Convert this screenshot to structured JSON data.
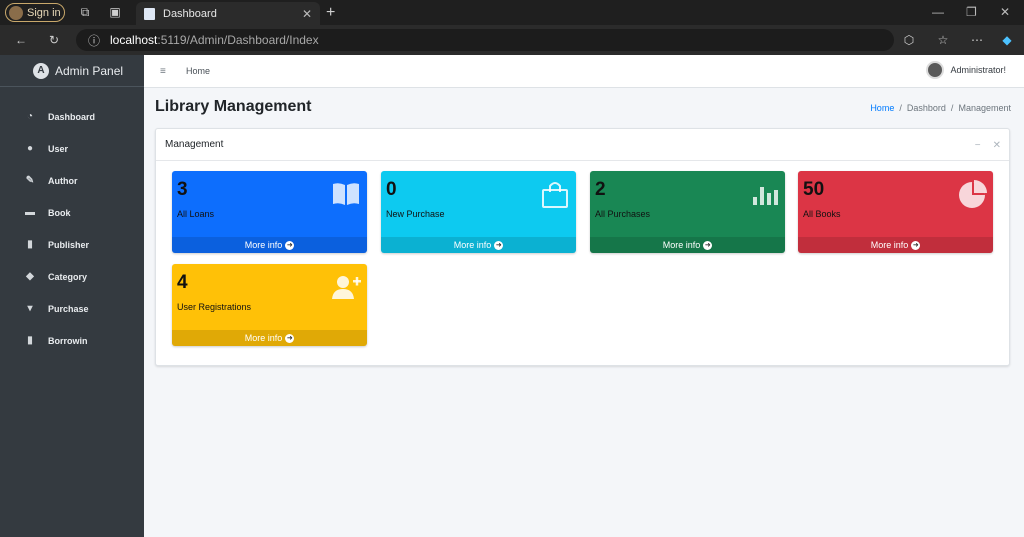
{
  "browser": {
    "signin_label": "Sign in",
    "tab_title": "Dashboard",
    "url_host": "localhost",
    "url_path": ":5119/Admin/Dashboard/Index"
  },
  "sidebar": {
    "brand": "Admin Panel",
    "items": [
      {
        "label": "Dashboard",
        "icon": "palette-icon"
      },
      {
        "label": "User",
        "icon": "user-icon"
      },
      {
        "label": "Author",
        "icon": "edit-icon"
      },
      {
        "label": "Book",
        "icon": "book-icon"
      },
      {
        "label": "Publisher",
        "icon": "publisher-icon"
      },
      {
        "label": "Category",
        "icon": "tag-icon"
      },
      {
        "label": "Purchase",
        "icon": "cart-icon"
      },
      {
        "label": "Borrowin",
        "icon": "bookmark-icon"
      }
    ]
  },
  "topnav": {
    "home": "Home",
    "user_name": "Administrator!"
  },
  "header": {
    "title": "Library Management",
    "breadcrumb": [
      "Home",
      "Dashbord",
      "Management"
    ]
  },
  "card": {
    "title": "Management"
  },
  "boxes": [
    {
      "value": "3",
      "label": "All Loans",
      "more": "More info",
      "color": "#0d6efd",
      "icon": "book-open-icon"
    },
    {
      "value": "0",
      "label": "New Purchase",
      "more": "More info",
      "color": "#0dcaf0",
      "icon": "shopping-bag-icon"
    },
    {
      "value": "2",
      "label": "All Purchases",
      "more": "More info",
      "color": "#198754",
      "icon": "bar-chart-icon"
    },
    {
      "value": "50",
      "label": "All Books",
      "more": "More info",
      "color": "#dc3545",
      "icon": "pie-chart-icon"
    },
    {
      "value": "4",
      "label": "User Registrations",
      "more": "More info",
      "color": "#ffc107",
      "icon": "user-plus-icon"
    }
  ]
}
